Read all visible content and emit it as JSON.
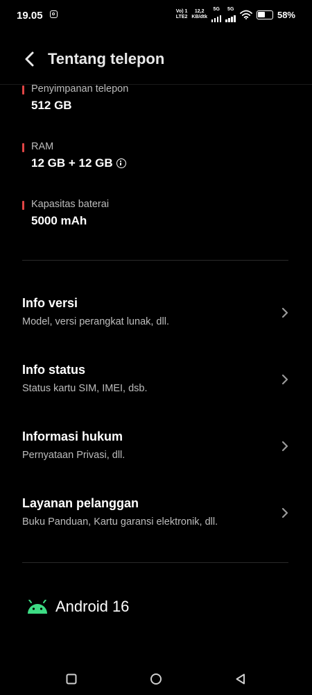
{
  "status_bar": {
    "time": "19.05",
    "volte_top": "Vo) 1",
    "volte_bottom": "LTE2",
    "speed_top": "12,2",
    "speed_bottom": "KB/dtk",
    "sim1_label": "5G",
    "sim2_label": "5G",
    "battery_pct": "58%",
    "battery_level": 0.58
  },
  "header": {
    "title": "Tentang telepon"
  },
  "specs": [
    {
      "label": "Penyimpanan telepon",
      "value": "512 GB"
    },
    {
      "label": "RAM",
      "value": "12 GB + 12 GB"
    },
    {
      "label": "Kapasitas baterai",
      "value": "5000 mAh"
    }
  ],
  "menu": [
    {
      "title": "Info versi",
      "subtitle": "Model, versi perangkat lunak, dll."
    },
    {
      "title": "Info status",
      "subtitle": "Status kartu SIM, IMEI, dsb."
    },
    {
      "title": "Informasi hukum",
      "subtitle": "Pernyataan Privasi, dll."
    },
    {
      "title": "Layanan pelanggan",
      "subtitle": "Buku Panduan, Kartu garansi elektronik, dll."
    }
  ],
  "android": {
    "label": "Android 16"
  },
  "colors": {
    "background": "#000000",
    "accent_bar": "#e04545",
    "android_green": "#3ddc84"
  }
}
